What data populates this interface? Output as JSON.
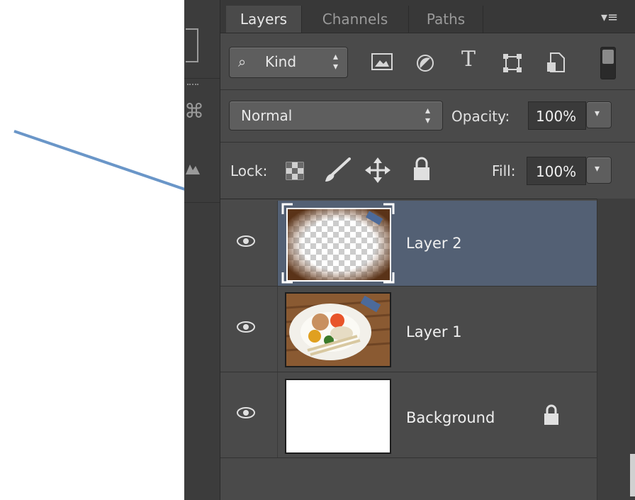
{
  "tabs": [
    {
      "label": "Layers",
      "active": true
    },
    {
      "label": "Channels",
      "active": false
    },
    {
      "label": "Paths",
      "active": false
    }
  ],
  "panel_menu_icon": "panel-menu-icon",
  "filter": {
    "kind_label": "Kind",
    "icons": [
      "image-filter-icon",
      "adjustment-filter-icon",
      "type-filter-icon",
      "shape-filter-icon",
      "smart-object-filter-icon"
    ]
  },
  "blend": {
    "mode": "Normal",
    "opacity_label": "Opacity:",
    "opacity_value": "100%"
  },
  "lock": {
    "label": "Lock:",
    "icons": [
      "lock-transparent-pixels-icon",
      "lock-image-pixels-icon",
      "lock-position-icon",
      "lock-all-icon"
    ],
    "fill_label": "Fill:",
    "fill_value": "100%"
  },
  "layers": [
    {
      "name": "Layer 2",
      "selected": true,
      "visible": true,
      "thumbnail": "transparent-vignette-food-photo"
    },
    {
      "name": "Layer 1",
      "selected": false,
      "visible": true,
      "thumbnail": "food-plate-photo"
    },
    {
      "name": "Background",
      "selected": false,
      "visible": true,
      "locked": true,
      "thumbnail": "white-fill"
    }
  ],
  "colors": {
    "panel_bg": "#4a4a4a",
    "selected_row": "#536074",
    "arrow": "#6a96c8"
  }
}
